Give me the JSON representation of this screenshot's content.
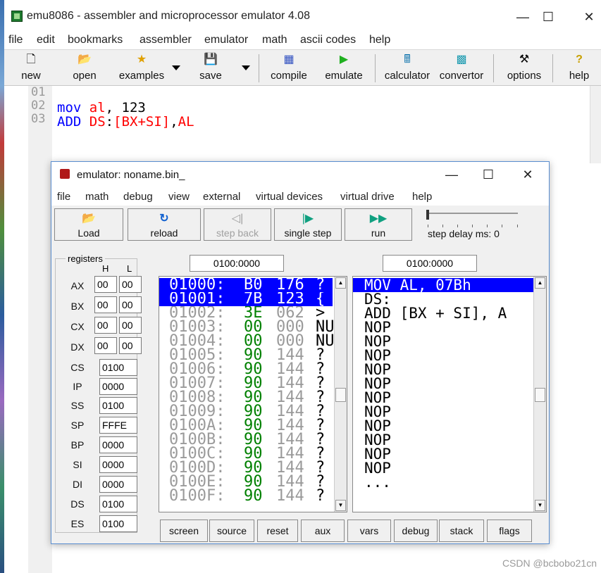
{
  "main_window": {
    "title": "emu8086 - assembler and microprocessor emulator 4.08",
    "controls": {
      "minimize": "—",
      "maximize": "☐",
      "close": "✕"
    },
    "menu": [
      "file",
      "edit",
      "bookmarks",
      "assembler",
      "emulator",
      "math",
      "ascii codes",
      "help"
    ],
    "toolbar": {
      "new": "new",
      "open": "open",
      "examples": "examples",
      "save": "save",
      "compile": "compile",
      "emulate": "emulate",
      "calculator": "calculator",
      "convertor": "convertor",
      "options": "options",
      "help": "help"
    }
  },
  "editor": {
    "line_numbers": [
      "01",
      "02",
      "03"
    ],
    "lines": [
      {
        "tokens": []
      },
      {
        "tokens": [
          {
            "text": "mov",
            "color": "#0000ff"
          },
          {
            "text": " ",
            "color": "#000000"
          },
          {
            "text": "al",
            "color": "#ff0000"
          },
          {
            "text": ", 123",
            "color": "#000000"
          }
        ]
      },
      {
        "tokens": [
          {
            "text": "ADD",
            "color": "#0000ff"
          },
          {
            "text": " ",
            "color": "#000000"
          },
          {
            "text": "DS",
            "color": "#ff0000"
          },
          {
            "text": ":",
            "color": "#000000"
          },
          {
            "text": "[BX+SI]",
            "color": "#ff0000"
          },
          {
            "text": ",",
            "color": "#000000"
          },
          {
            "text": "AL",
            "color": "#ff0000"
          }
        ]
      }
    ]
  },
  "emulator": {
    "title": "emulator: noname.bin_",
    "controls": {
      "minimize": "—",
      "maximize": "☐",
      "close": "✕"
    },
    "menu": [
      "file",
      "math",
      "debug",
      "view",
      "external",
      "virtual devices",
      "virtual drive",
      "help"
    ],
    "toolbar": {
      "load": "Load",
      "reload": "reload",
      "step_back": "step back",
      "single_step": "single step",
      "run": "run",
      "step_delay": "step delay ms: 0"
    },
    "registers": {
      "legend": "registers",
      "h_label": "H",
      "l_label": "L",
      "split": [
        {
          "name": "AX",
          "h": "00",
          "l": "00"
        },
        {
          "name": "BX",
          "h": "00",
          "l": "00"
        },
        {
          "name": "CX",
          "h": "00",
          "l": "00"
        },
        {
          "name": "DX",
          "h": "00",
          "l": "00"
        }
      ],
      "full": [
        {
          "name": "CS",
          "value": "0100"
        },
        {
          "name": "IP",
          "value": "0000"
        },
        {
          "name": "SS",
          "value": "0100"
        },
        {
          "name": "SP",
          "value": "FFFE"
        },
        {
          "name": "BP",
          "value": "0000"
        },
        {
          "name": "SI",
          "value": "0000"
        },
        {
          "name": "DI",
          "value": "0000"
        },
        {
          "name": "DS",
          "value": "0100"
        },
        {
          "name": "ES",
          "value": "0100"
        }
      ]
    },
    "memory_address": "0100:0000",
    "disasm_address": "0100:0000",
    "memory": [
      {
        "addr": "01000:",
        "hex": "B0",
        "dec": "176",
        "chr": "?",
        "selected": true
      },
      {
        "addr": "01001:",
        "hex": "7B",
        "dec": "123",
        "chr": "{",
        "selected": true
      },
      {
        "addr": "01002:",
        "hex": "3E",
        "dec": "062",
        "chr": ">",
        "selected": false
      },
      {
        "addr": "01003:",
        "hex": "00",
        "dec": "000",
        "chr": "NU",
        "selected": false
      },
      {
        "addr": "01004:",
        "hex": "00",
        "dec": "000",
        "chr": "NU",
        "selected": false
      },
      {
        "addr": "01005:",
        "hex": "90",
        "dec": "144",
        "chr": "?",
        "selected": false
      },
      {
        "addr": "01006:",
        "hex": "90",
        "dec": "144",
        "chr": "?",
        "selected": false
      },
      {
        "addr": "01007:",
        "hex": "90",
        "dec": "144",
        "chr": "?",
        "selected": false
      },
      {
        "addr": "01008:",
        "hex": "90",
        "dec": "144",
        "chr": "?",
        "selected": false
      },
      {
        "addr": "01009:",
        "hex": "90",
        "dec": "144",
        "chr": "?",
        "selected": false
      },
      {
        "addr": "0100A:",
        "hex": "90",
        "dec": "144",
        "chr": "?",
        "selected": false
      },
      {
        "addr": "0100B:",
        "hex": "90",
        "dec": "144",
        "chr": "?",
        "selected": false
      },
      {
        "addr": "0100C:",
        "hex": "90",
        "dec": "144",
        "chr": "?",
        "selected": false
      },
      {
        "addr": "0100D:",
        "hex": "90",
        "dec": "144",
        "chr": "?",
        "selected": false
      },
      {
        "addr": "0100E:",
        "hex": "90",
        "dec": "144",
        "chr": "?",
        "selected": false
      },
      {
        "addr": "0100F:",
        "hex": "90",
        "dec": "144",
        "chr": "?",
        "selected": false
      }
    ],
    "disassembly": [
      {
        "text": "MOV AL, 07Bh",
        "selected": true
      },
      {
        "text": "DS:",
        "selected": false
      },
      {
        "text": "ADD [BX + SI], A",
        "selected": false
      },
      {
        "text": "NOP",
        "selected": false
      },
      {
        "text": "NOP",
        "selected": false
      },
      {
        "text": "NOP",
        "selected": false
      },
      {
        "text": "NOP",
        "selected": false
      },
      {
        "text": "NOP",
        "selected": false
      },
      {
        "text": "NOP",
        "selected": false
      },
      {
        "text": "NOP",
        "selected": false
      },
      {
        "text": "NOP",
        "selected": false
      },
      {
        "text": "NOP",
        "selected": false
      },
      {
        "text": "NOP",
        "selected": false
      },
      {
        "text": "NOP",
        "selected": false
      },
      {
        "text": "...",
        "selected": false
      }
    ],
    "bottom_buttons": [
      "screen",
      "source",
      "reset",
      "aux",
      "vars",
      "debug",
      "stack",
      "flags"
    ]
  },
  "watermark": "CSDN @bcbobo21cn",
  "colors": {
    "selection": "#0000ff",
    "hex_green": "#008000",
    "address_gray": "#9a9a9a",
    "keyword_blue": "#0000ff",
    "operand_red": "#ff0000"
  }
}
